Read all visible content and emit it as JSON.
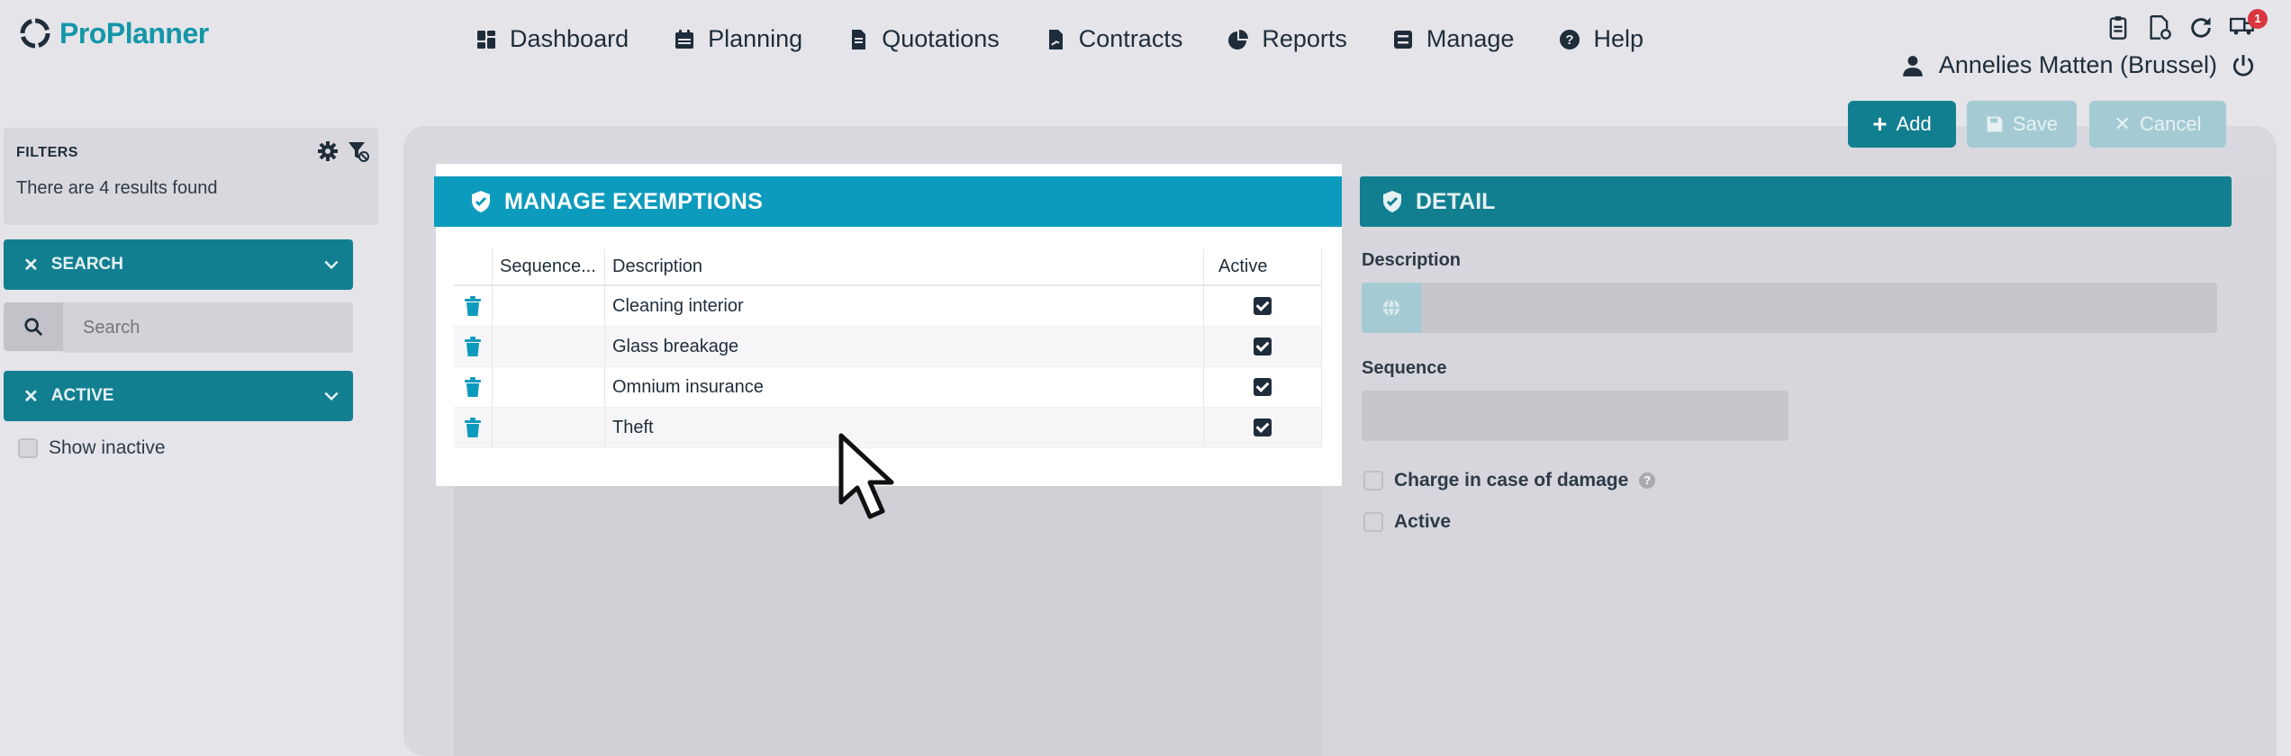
{
  "app": {
    "name": "ProPlanner",
    "brand_color": "#1496a9",
    "accent_color": "#0d9bbd"
  },
  "nav": [
    {
      "label": "Dashboard",
      "icon": "dashboard-icon"
    },
    {
      "label": "Planning",
      "icon": "calendar-icon"
    },
    {
      "label": "Quotations",
      "icon": "document-icon"
    },
    {
      "label": "Contracts",
      "icon": "contract-icon"
    },
    {
      "label": "Reports",
      "icon": "pie-chart-icon"
    },
    {
      "label": "Manage",
      "icon": "manage-icon"
    },
    {
      "label": "Help",
      "icon": "help-icon"
    }
  ],
  "topbar": {
    "notification_count": "1",
    "icons": [
      "clipboard-icon",
      "file-settings-icon",
      "refresh-icon",
      "truck-icon"
    ]
  },
  "user": {
    "name": "Annelies Matten (Brussel)"
  },
  "actions": {
    "add": "Add",
    "save": "Save",
    "cancel": "Cancel"
  },
  "filters": {
    "title": "FILTERS",
    "results": "There are 4 results found",
    "search_section": "SEARCH",
    "search_placeholder": "Search",
    "active_section": "ACTIVE",
    "show_inactive": "Show inactive"
  },
  "exemptions": {
    "title": "MANAGE EXEMPTIONS",
    "columns": {
      "sequence": "Sequence...",
      "description": "Description",
      "active": "Active"
    },
    "rows": [
      {
        "sequence": "",
        "description": "Cleaning interior",
        "active": true
      },
      {
        "sequence": "",
        "description": "Glass breakage",
        "active": true
      },
      {
        "sequence": "",
        "description": "Omnium insurance",
        "active": true
      },
      {
        "sequence": "",
        "description": "Theft",
        "active": true
      }
    ]
  },
  "detail": {
    "title": "DETAIL",
    "description_label": "Description",
    "sequence_label": "Sequence",
    "charge_label": "Charge in case of damage",
    "active_label": "Active"
  }
}
